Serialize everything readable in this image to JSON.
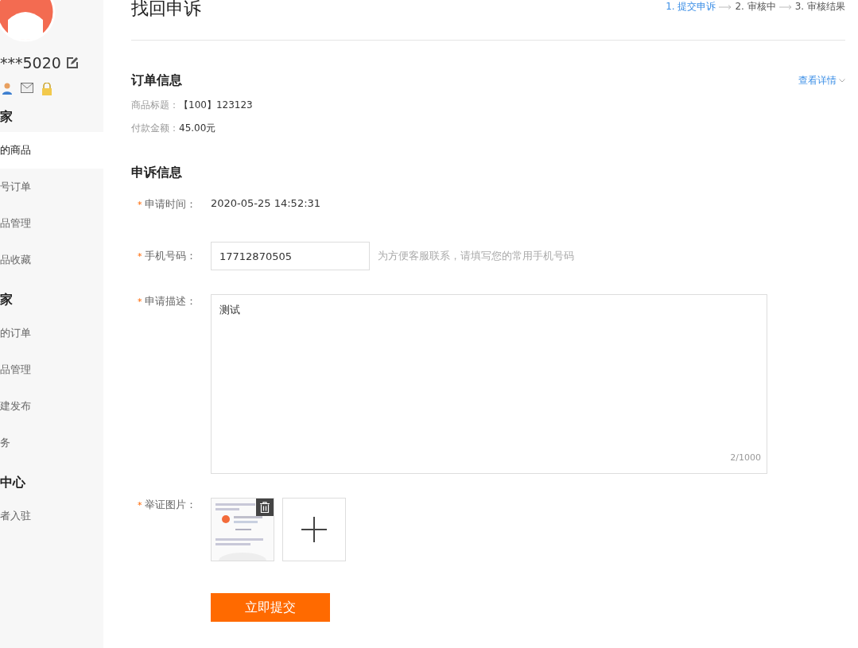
{
  "sidebar": {
    "username": "***5020",
    "sections": [
      {
        "heading": "家",
        "items": [
          {
            "label": "的商品",
            "selected": true
          },
          {
            "label": "号订单",
            "selected": false
          },
          {
            "label": "品管理",
            "selected": false
          },
          {
            "label": "品收藏",
            "selected": false
          }
        ]
      },
      {
        "heading": "家",
        "items": [
          {
            "label": "的订单",
            "selected": false
          },
          {
            "label": "品管理",
            "selected": false
          },
          {
            "label": "建发布",
            "selected": false
          },
          {
            "label": "务",
            "selected": false
          }
        ]
      },
      {
        "heading": "中心",
        "items": [
          {
            "label": "者入驻",
            "selected": false
          }
        ]
      }
    ]
  },
  "page_title": "找回申诉",
  "steps": [
    {
      "label": "1. 提交申诉",
      "selected": true
    },
    {
      "label": "2. 审核中",
      "selected": false
    },
    {
      "label": "3. 审核结果",
      "selected": false
    }
  ],
  "order_info": {
    "heading": "订单信息",
    "details_link": "查看详情",
    "rows": [
      {
        "label": "商品标题：",
        "value": "【100】123123"
      },
      {
        "label": "付款金额：",
        "value": "45.00元"
      }
    ]
  },
  "appeal_info": {
    "heading": "申诉信息",
    "apply_time": {
      "required_mark": "*",
      "label": "申请时间：",
      "value": "2020-05-25 14:52:31"
    },
    "phone": {
      "required_mark": "*",
      "label": "手机号码：",
      "value": "17712870505",
      "hint": "为方便客服联系，请填写您的常用手机号码"
    },
    "description": {
      "required_mark": "*",
      "label": "申请描述：",
      "value": "测试",
      "counter": "2/1000"
    },
    "evidence": {
      "required_mark": "*",
      "label": "举证图片："
    },
    "submit": "立即提交"
  }
}
